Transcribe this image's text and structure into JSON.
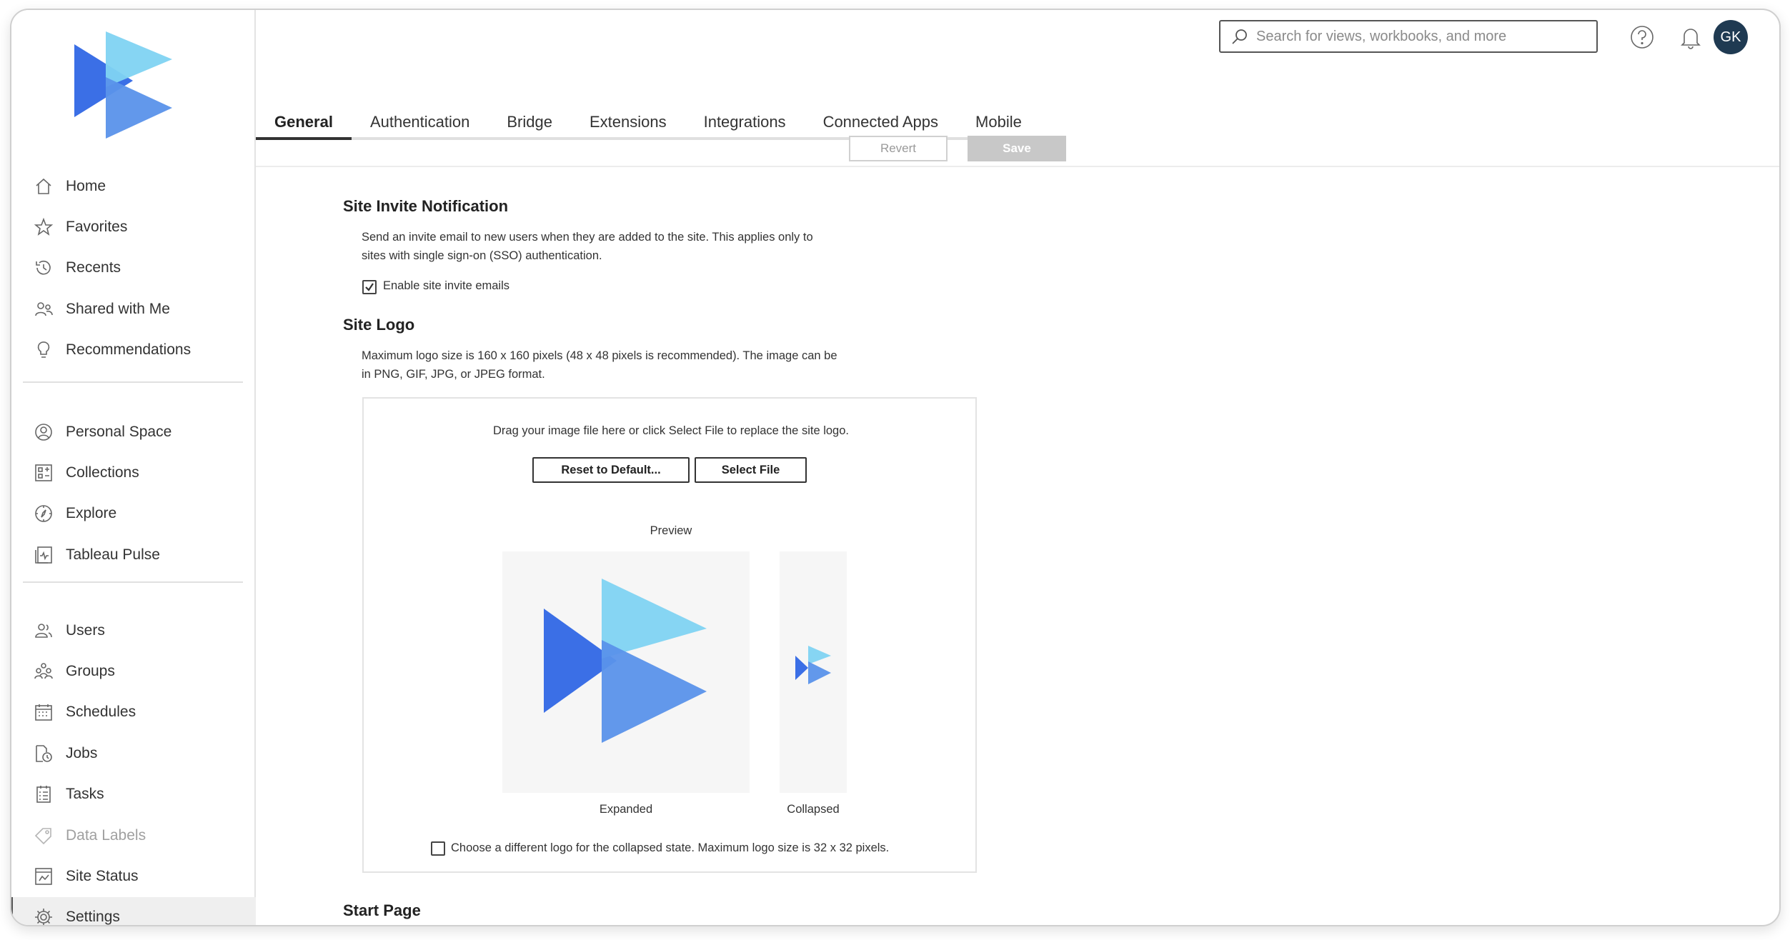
{
  "sidebar": {
    "logo_icon": "tableau-play-logo",
    "groups": [
      [
        {
          "label": "Home",
          "icon": "home-icon"
        },
        {
          "label": "Favorites",
          "icon": "star-icon"
        },
        {
          "label": "Recents",
          "icon": "history-icon"
        },
        {
          "label": "Shared with Me",
          "icon": "shared-users-icon"
        },
        {
          "label": "Recommendations",
          "icon": "lightbulb-icon"
        }
      ],
      [
        {
          "label": "Personal Space",
          "icon": "person-circle-icon"
        },
        {
          "label": "Collections",
          "icon": "collections-icon"
        },
        {
          "label": "Explore",
          "icon": "compass-icon"
        },
        {
          "label": "Tableau Pulse",
          "icon": "pulse-icon"
        }
      ],
      [
        {
          "label": "Users",
          "icon": "users-icon"
        },
        {
          "label": "Groups",
          "icon": "groups-icon"
        },
        {
          "label": "Schedules",
          "icon": "calendar-icon"
        },
        {
          "label": "Jobs",
          "icon": "jobs-icon"
        },
        {
          "label": "Tasks",
          "icon": "tasks-icon"
        },
        {
          "label": "Data Labels",
          "icon": "tag-icon",
          "disabled": true
        },
        {
          "label": "Site Status",
          "icon": "site-status-icon"
        },
        {
          "label": "Settings",
          "icon": "gear-icon",
          "active": true
        }
      ]
    ]
  },
  "header": {
    "search_placeholder": "Search for views, workbooks, and more",
    "avatar_initials": "GK"
  },
  "tabs": [
    {
      "label": "General",
      "active": true
    },
    {
      "label": "Authentication"
    },
    {
      "label": "Bridge"
    },
    {
      "label": "Extensions"
    },
    {
      "label": "Integrations"
    },
    {
      "label": "Connected Apps"
    },
    {
      "label": "Mobile"
    }
  ],
  "actions": {
    "revert_label": "Revert",
    "save_label": "Save"
  },
  "invite": {
    "title": "Site Invite Notification",
    "desc_line1": "Send an invite email to new users when they are added to the site. This applies only to",
    "desc_line2": "sites with single sign-on (SSO) authentication.",
    "checkbox_label": "Enable site invite emails",
    "checked": true
  },
  "site_logo": {
    "title": "Site Logo",
    "desc_line1": "Maximum logo size is 160 x 160 pixels (48 x 48 pixels is recommended). The image can be",
    "desc_line2": "in PNG, GIF, JPG, or JPEG format.",
    "drop_text": "Drag your image file here or click Select File to replace the site logo.",
    "reset_label": "Reset to Default...",
    "select_label": "Select File",
    "preview_label": "Preview",
    "expanded_label": "Expanded",
    "collapsed_label": "Collapsed",
    "collapsed_checkbox_label": "Choose a different logo for the collapsed state. Maximum logo size is 32 x 32 pixels.",
    "collapsed_checked": false
  },
  "start_page": {
    "title": "Start Page"
  },
  "colors": {
    "accent_dark": "#1f3a52",
    "logo_blue": "#3b6fe6",
    "logo_light": "#7fd3f2",
    "logo_mid": "#5a92ea"
  }
}
